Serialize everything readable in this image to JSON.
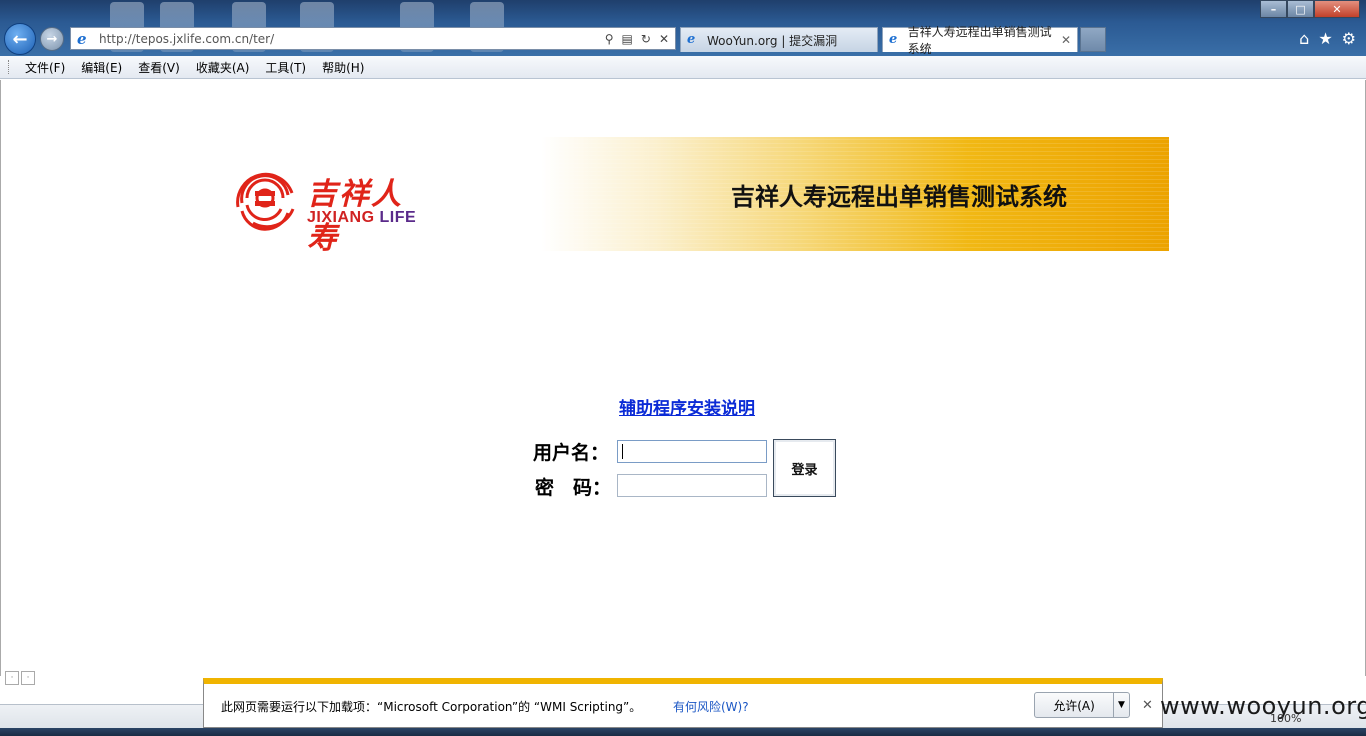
{
  "browser": {
    "url": "http://tepos.jxlife.com.cn/ter/",
    "tabs": [
      {
        "label": "WooYun.org | 提交漏洞"
      },
      {
        "label": "吉祥人寿远程出单销售测试系统"
      }
    ],
    "menu": [
      "文件(F)",
      "编辑(E)",
      "查看(V)",
      "收藏夹(A)",
      "工具(T)",
      "帮助(H)"
    ],
    "zoom": "100%"
  },
  "page": {
    "logo": {
      "cn": "吉祥人寿",
      "en_main": "JIXIANG ",
      "en_life": "LIFE"
    },
    "banner_title": "吉祥人寿远程出单销售测试系统",
    "help_link": "辅助程序安装说明",
    "username_label": "用户名：",
    "password_label": "密　码：",
    "login_button": "登录"
  },
  "notification": {
    "message": "此网页需要运行以下加载项：“Microsoft Corporation”的 “WMI Scripting”。",
    "risk_link": "有何风险(W)?",
    "allow_button": "允许(A)"
  },
  "watermark": "www.wooyun.org",
  "colors": {
    "brand_red": "#e02419",
    "banner_gold": "#eca300",
    "link_blue": "#0b2bd6",
    "notify_bar": "#f0b400"
  }
}
